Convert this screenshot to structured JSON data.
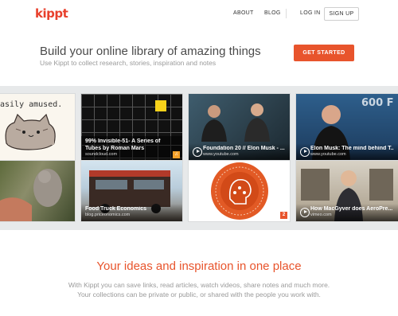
{
  "header": {
    "logo": "kippt",
    "nav": {
      "about": "ABOUT",
      "blog": "BLOG",
      "login": "LOG IN",
      "signup": "SIGN UP"
    }
  },
  "hero": {
    "title": "Build your online library of amazing things",
    "subtitle": "Use Kippt to collect research, stories, inspiration and notes",
    "cta": "GET STARTED"
  },
  "cards": {
    "c1": {
      "text": "asily amused."
    },
    "c2": {
      "title": "99% Invisible-51- A Series of Tubes by Roman Mars",
      "domain": "soundcloud.com"
    },
    "c3": {
      "title": "Foundation 20 // Elon Musk - ...",
      "domain": "www.youtube.com"
    },
    "c4": {
      "title": "Elon Musk: The mind behind T...",
      "domain": "www.youtube.com"
    },
    "c6": {
      "title": "Food Truck Economics",
      "domain": "blog.priceonomics.com"
    },
    "c7": {
      "badge": "2"
    },
    "c8": {
      "title": "How MacGyver does AeroPre...",
      "domain": "vimeo.com"
    }
  },
  "section": {
    "title": "Your ideas and inspiration in one place",
    "line1": "With Kippt you can save links, read articles, watch videos, share notes and much more.",
    "line2": "Your collections can be private or public, or shared with the people you work with."
  },
  "colors": {
    "brand": "#e8402c",
    "accent": "#e8542c",
    "badge": "#f4a12a"
  }
}
